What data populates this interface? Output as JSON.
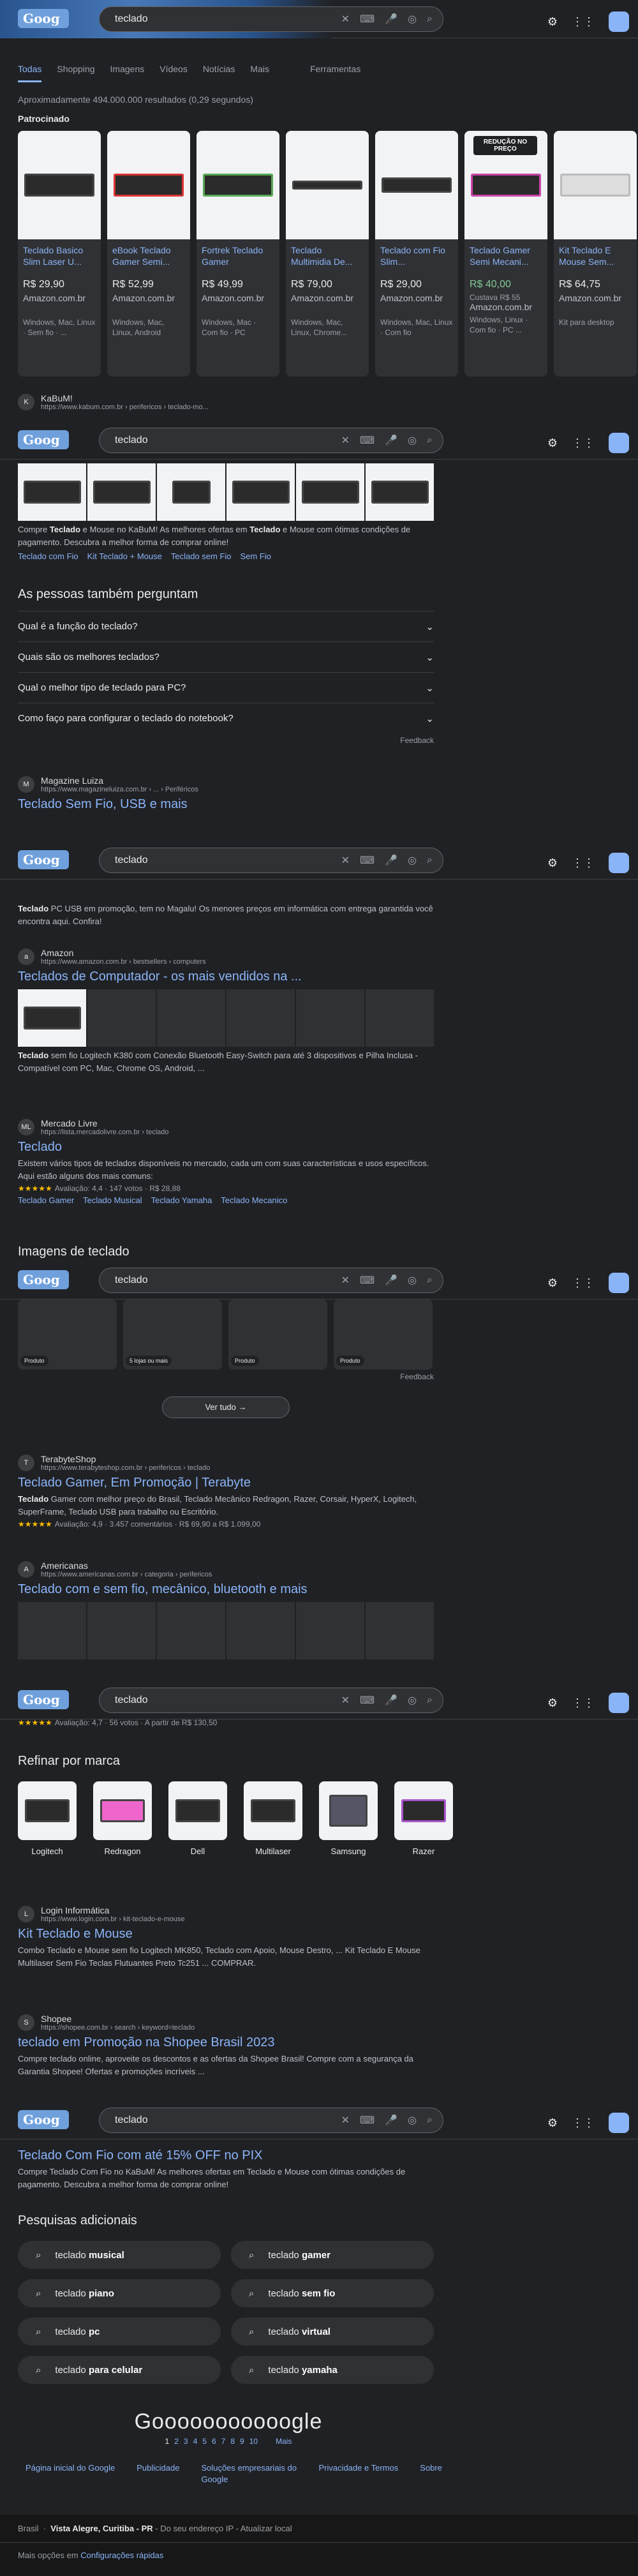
{
  "search": {
    "query": "teclado"
  },
  "nav": {
    "tabs": [
      "Todas",
      "Shopping",
      "Imagens",
      "Vídeos",
      "Notícias",
      "Mais"
    ],
    "tools": "Ferramentas"
  },
  "stats": "Aproximadamente 494.000.000 resultados (0,29 segundos)",
  "sponsored": "Patrocinado",
  "products": [
    {
      "title": "Teclado Basico Slim Laser U...",
      "price": "R$ 29,90",
      "store": "Amazon.com.br",
      "extra": "Windows, Mac, Linux · Sem fio · ..."
    },
    {
      "title": "eBook Teclado Gamer Semi...",
      "price": "R$ 52,99",
      "store": "Amazon.com.br",
      "extra": "Windows, Mac, Linux, Android"
    },
    {
      "title": "Fortrek Teclado Gamer",
      "price": "R$ 49,99",
      "store": "Amazon.com.br",
      "extra": "Windows, Mac · Com fio · PC"
    },
    {
      "title": "Teclado Multimidia De...",
      "price": "R$ 79,00",
      "store": "Amazon.com.br",
      "extra": "Windows, Mac, Linux, Chrome..."
    },
    {
      "title": "Teclado com Fio Slim...",
      "price": "R$ 29,00",
      "store": "Amazon.com.br",
      "extra": "Windows, Mac, Linux · Com fio"
    },
    {
      "title": "Teclado Gamer Semi Mecani...",
      "price": "R$ 40,00",
      "store": "Amazon.com.br",
      "extra": "Windows, Linux · Com fio · PC ...",
      "badge": "REDUÇÃO NO PREÇO",
      "was": "Custava R$ 55"
    },
    {
      "title": "Kit Teclado E Mouse Sem...",
      "price": "R$ 64,75",
      "store": "Amazon.com.br",
      "extra": "Kit para desktop"
    }
  ],
  "kabum": {
    "name": "KaBuM!",
    "url": "https://www.kabum.com.br › perifericos › teclado-mo...",
    "snippet_pre": "Compre ",
    "b1": "Teclado",
    "snippet_mid": " e Mouse no KaBuM! As melhores ofertas em ",
    "b2": "Teclado",
    "snippet_post": " e Mouse com ótimas condições de pagamento. Descubra a melhor forma de comprar online!",
    "links": [
      "Teclado com Fio",
      "Kit Teclado + Mouse",
      "Teclado sem Fio",
      "Sem Fio"
    ]
  },
  "paa": {
    "title": "As pessoas também perguntam",
    "questions": [
      "Qual é a função do teclado?",
      "Quais são os melhores teclados?",
      "Qual o melhor tipo de teclado para PC?",
      "Como faço para configurar o teclado do notebook?"
    ],
    "feedback": "Feedback"
  },
  "magalu": {
    "name": "Magazine Luiza",
    "url": "https://www.magazineluiza.com.br › ... › Periféricos",
    "title": "Teclado Sem Fio, USB e mais",
    "snippet": "PC USB em promoção, tem no Magalu! Os menores preços em informática com entrega garantida você encontra aqui. Confira!",
    "b": "Teclado"
  },
  "amazon": {
    "name": "Amazon",
    "url": "https://www.amazon.com.br › bestsellers › computers",
    "title": "Teclados de Computador - os mais vendidos na ...",
    "snippet": "sem fio Logitech K380 com Conexão Bluetooth Easy-Switch para até 3 dispositivos e Pilha Inclusa - Compatível com PC, Mac, Chrome OS, Android, ...",
    "b": "Teclado"
  },
  "ml": {
    "name": "Mercado Livre",
    "url": "https://lista.mercadolivre.com.br › teclado",
    "title": "Teclado",
    "snippet": "Existem vários tipos de teclados disponíveis no mercado, cada um com suas características e usos específicos. Aqui estão alguns dos mais comuns:",
    "rating": "Avaliação: 4,4 · 147 votos · R$ 28,88",
    "links": [
      "Teclado Gamer",
      "Teclado Musical",
      "Teclado Yamaha",
      "Teclado Mecanico"
    ]
  },
  "images": {
    "title": "Imagens de teclado",
    "tags": [
      "Produto",
      "5 lojas ou mais",
      "Produto",
      "Produto"
    ],
    "seeall": "Ver tudo",
    "feedback": "Feedback"
  },
  "terabyte": {
    "name": "TerabyteShop",
    "url": "https://www.terabyteshop.com.br › perifericos › teclado",
    "title": "Teclado Gamer, Em Promoção | Terabyte",
    "snippet": "Gamer com melhor preço do Brasil, Teclado Mecânico Redragon, Razer, Corsair, HyperX, Logitech, SuperFrame, Teclado USB para trabalho ou Escritório.",
    "b": "Teclado",
    "rating": "Avaliação: 4,9 · 3.457 comentários · R$ 69,90 a R$ 1.099,00"
  },
  "americanas": {
    "name": "Americanas",
    "url": "https://www.americanas.com.br › categoria › perifericos",
    "title": "Teclado com e sem fio, mecânico, bluetooth e mais",
    "rating": "Avaliação: 4,7 · 56 votos · A partir de R$ 130,50"
  },
  "brands": {
    "title": "Refinar por marca",
    "list": [
      "Logitech",
      "Redragon",
      "Dell",
      "Multilaser",
      "Samsung",
      "Razer"
    ]
  },
  "login": {
    "name": "Login Informática",
    "url": "https://www.login.com.br › kit-teclado-e-mouse",
    "title": "Kit Teclado e Mouse",
    "snippet": "Combo Teclado e Mouse sem fio Logitech MK850, Teclado com Apoio, Mouse Destro, ... Kit Teclado E Mouse Multilaser Sem Fio Teclas Flutuantes Preto Tc251 ... COMPRAR."
  },
  "shopee": {
    "name": "Shopee",
    "url": "https://shopee.com.br › search › keyword=teclado",
    "title": "teclado em Promoção na Shopee Brasil 2023",
    "snippet": "Compre teclado online, aproveite os descontos e as ofertas da Shopee Brasil! Compre com a segurança da Garantia Shopee! Ofertas e promoções incríveis ..."
  },
  "kabum2": {
    "title": "Teclado Com Fio com até 15% OFF no PIX",
    "snippet": "Compre Teclado Com Fio no KaBuM! As melhores ofertas em Teclado e Mouse com ótimas condições de pagamento. Descubra a melhor forma de comprar online!"
  },
  "additional": {
    "title": "Pesquisas adicionais",
    "items": [
      {
        "a": "teclado ",
        "b": "musical"
      },
      {
        "a": "teclado ",
        "b": "gamer"
      },
      {
        "a": "teclado ",
        "b": "piano"
      },
      {
        "a": "teclado ",
        "b": "sem fio"
      },
      {
        "a": "teclado ",
        "b": "pc"
      },
      {
        "a": "teclado ",
        "b": "virtual"
      },
      {
        "a": "teclado ",
        "b": "para celular"
      },
      {
        "a": "teclado ",
        "b": "yamaha"
      }
    ]
  },
  "pagination": {
    "logo": "Gooooooooooogle",
    "pages": [
      "1",
      "2",
      "3",
      "4",
      "5",
      "6",
      "7",
      "8",
      "9",
      "10"
    ],
    "more": "Mais"
  },
  "footer_links": [
    "Página inicial do Google",
    "Publicidade",
    "Soluções empresariais do Google",
    "Privacidade e Termos",
    "Sobre"
  ],
  "footer": {
    "country": "Brasil",
    "loc": "Vista Alegre, Curitiba - PR",
    "loc_extra": " - Do seu endereço IP - Atualizar local",
    "more": "Mais opções em ",
    "quick": "Configurações rápidas"
  }
}
